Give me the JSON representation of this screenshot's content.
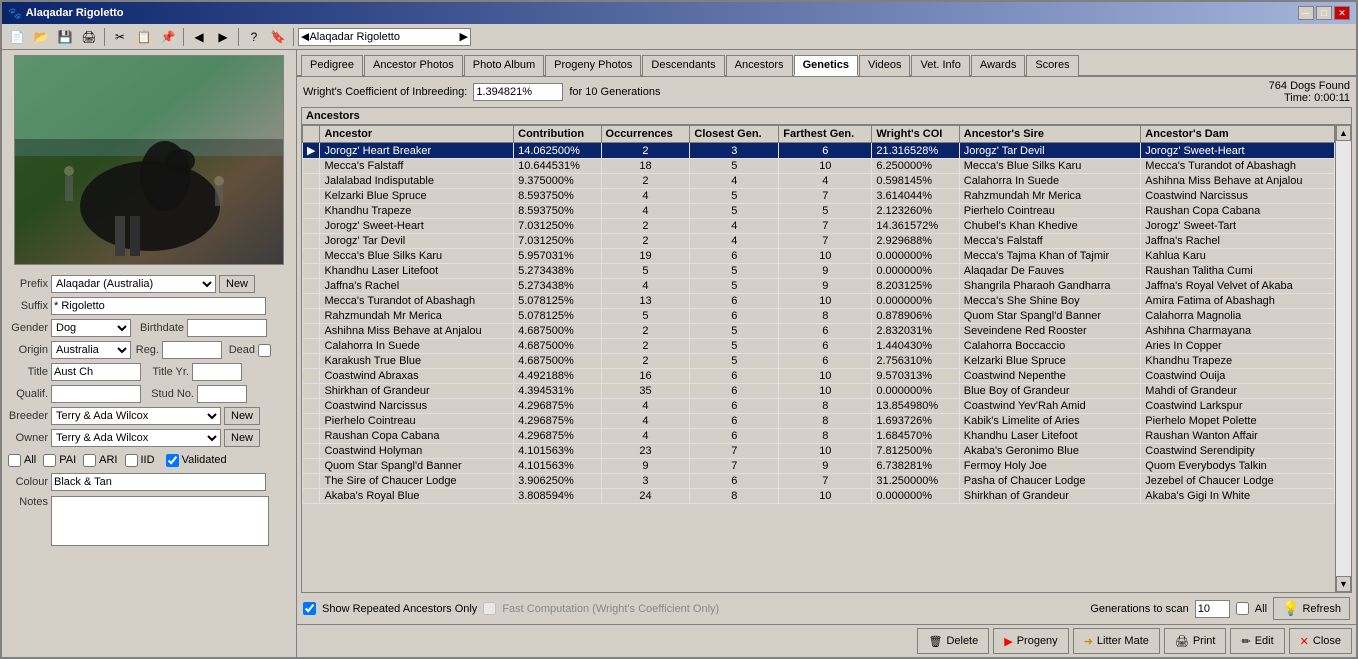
{
  "window": {
    "title": "Alaqadar Rigoletto",
    "app_icon": "🐾"
  },
  "toolbar": {
    "search_value": "Alaqadar Rigoletto",
    "search_placeholder": "Search..."
  },
  "dog": {
    "prefix_label": "Prefix",
    "prefix_value": "Alaqadar (Australia)",
    "suffix_label": "Suffix",
    "suffix_value": "* Rigoletto",
    "gender_label": "Gender",
    "gender_value": "Dog",
    "birthdate_label": "Birthdate",
    "birthdate_value": "/ /",
    "origin_label": "Origin",
    "origin_value": "Australia",
    "reg_label": "Reg.",
    "dead_label": "Dead",
    "title_label": "Title",
    "title_value": "Aust Ch",
    "title_yr_label": "Title Yr.",
    "title_yr_value": "",
    "qualif_label": "Qualif.",
    "stud_no_label": "Stud No.",
    "breeder_label": "Breeder",
    "breeder_value": "Terry & Ada Wilcox",
    "owner_label": "Owner",
    "owner_value": "Terry & Ada Wilcox",
    "all_label": "All",
    "pai_label": "PAI",
    "ari_label": "ARI",
    "iid_label": "IID",
    "validated_label": "Validated",
    "colour_label": "Colour",
    "colour_value": "Black & Tan",
    "notes_label": "Notes",
    "new_prefix_btn": "New",
    "new_breeder_btn": "New",
    "new_owner_btn": "New"
  },
  "tabs": [
    {
      "id": "pedigree",
      "label": "Pedigree"
    },
    {
      "id": "ancestor-photos",
      "label": "Ancestor Photos"
    },
    {
      "id": "photo-album",
      "label": "Photo Album"
    },
    {
      "id": "progeny-photos",
      "label": "Progeny Photos"
    },
    {
      "id": "descendants",
      "label": "Descendants"
    },
    {
      "id": "ancestors",
      "label": "Ancestors"
    },
    {
      "id": "genetics",
      "label": "Genetics",
      "active": true
    },
    {
      "id": "videos",
      "label": "Videos"
    },
    {
      "id": "vet-info",
      "label": "Vet. Info"
    },
    {
      "id": "awards",
      "label": "Awards"
    },
    {
      "id": "scores",
      "label": "Scores"
    }
  ],
  "genetics": {
    "coeff_label": "Wright's Coefficient of Inbreeding:",
    "coeff_value": "1.394821%",
    "generations_label": "for 10 Generations",
    "status": {
      "dogs_found": "764 Dogs Found",
      "time": "Time: 0:00:11"
    },
    "ancestors_title": "Ancestors",
    "columns": [
      {
        "id": "ancestor",
        "label": "Ancestor"
      },
      {
        "id": "contribution",
        "label": "Contribution"
      },
      {
        "id": "occurrences",
        "label": "Occurrences"
      },
      {
        "id": "closest_gen",
        "label": "Closest Gen."
      },
      {
        "id": "farthest_gen",
        "label": "Farthest Gen."
      },
      {
        "id": "wrights_coi",
        "label": "Wright's COI"
      },
      {
        "id": "ancestor_sire",
        "label": "Ancestor's Sire"
      },
      {
        "id": "ancestor_dam",
        "label": "Ancestor's Dam"
      }
    ],
    "rows": [
      {
        "ancestor": "Jorogz' Heart Breaker",
        "contribution": "14.062500%",
        "occurrences": "2",
        "closest": "3",
        "farthest": "6",
        "coi": "21.316528%",
        "sire": "Jorogz' Tar Devil",
        "dam": "Jorogz' Sweet-Heart",
        "selected": true
      },
      {
        "ancestor": "Mecca's Falstaff",
        "contribution": "10.644531%",
        "occurrences": "18",
        "closest": "5",
        "farthest": "10",
        "coi": "6.250000%",
        "sire": "Mecca's Blue Silks Karu",
        "dam": "Mecca's Turandot of Abashagh"
      },
      {
        "ancestor": "Jalalabad Indisputable",
        "contribution": "9.375000%",
        "occurrences": "2",
        "closest": "4",
        "farthest": "4",
        "coi": "0.598145%",
        "sire": "Calahorra In Suede",
        "dam": "Ashihna Miss Behave at Anjalou"
      },
      {
        "ancestor": "Kelzarki Blue Spruce",
        "contribution": "8.593750%",
        "occurrences": "4",
        "closest": "5",
        "farthest": "7",
        "coi": "3.614044%",
        "sire": "Rahzmundah Mr Merica",
        "dam": "Coastwind Narcissus"
      },
      {
        "ancestor": "Khandhu Trapeze",
        "contribution": "8.593750%",
        "occurrences": "4",
        "closest": "5",
        "farthest": "5",
        "coi": "2.123260%",
        "sire": "Pierhelo Cointreau",
        "dam": "Raushan Copa Cabana"
      },
      {
        "ancestor": "Jorogz' Sweet-Heart",
        "contribution": "7.031250%",
        "occurrences": "2",
        "closest": "4",
        "farthest": "7",
        "coi": "14.361572%",
        "sire": "Chubel's Khan Khedive",
        "dam": "Jorogz' Sweet-Tart"
      },
      {
        "ancestor": "Jorogz' Tar Devil",
        "contribution": "7.031250%",
        "occurrences": "2",
        "closest": "4",
        "farthest": "7",
        "coi": "2.929688%",
        "sire": "Mecca's Falstaff",
        "dam": "Jaffna's Rachel"
      },
      {
        "ancestor": "Mecca's Blue Silks Karu",
        "contribution": "5.957031%",
        "occurrences": "19",
        "closest": "6",
        "farthest": "10",
        "coi": "0.000000%",
        "sire": "Mecca's Tajma Khan of Tajmir",
        "dam": "Kahlua Karu"
      },
      {
        "ancestor": "Khandhu Laser Litefoot",
        "contribution": "5.273438%",
        "occurrences": "5",
        "closest": "5",
        "farthest": "9",
        "coi": "0.000000%",
        "sire": "Alaqadar De Fauves",
        "dam": "Raushan Talitha Cumi"
      },
      {
        "ancestor": "Jaffna's Rachel",
        "contribution": "5.273438%",
        "occurrences": "4",
        "closest": "5",
        "farthest": "9",
        "coi": "8.203125%",
        "sire": "Shangrila Pharaoh Gandharra",
        "dam": "Jaffna's Royal Velvet  of Akaba"
      },
      {
        "ancestor": "Mecca's Turandot of Abashagh",
        "contribution": "5.078125%",
        "occurrences": "13",
        "closest": "6",
        "farthest": "10",
        "coi": "0.000000%",
        "sire": "Mecca's She Shine Boy",
        "dam": "Amira Fatima of Abashagh"
      },
      {
        "ancestor": "Rahzmundah Mr Merica",
        "contribution": "5.078125%",
        "occurrences": "5",
        "closest": "6",
        "farthest": "8",
        "coi": "0.878906%",
        "sire": "Quom Star Spangl'd Banner",
        "dam": "Calahorra Magnolia"
      },
      {
        "ancestor": "Ashihna Miss Behave at Anjalou",
        "contribution": "4.687500%",
        "occurrences": "2",
        "closest": "5",
        "farthest": "6",
        "coi": "2.832031%",
        "sire": "Seveindene Red Rooster",
        "dam": "Ashihna Charmayana"
      },
      {
        "ancestor": "Calahorra In Suede",
        "contribution": "4.687500%",
        "occurrences": "2",
        "closest": "5",
        "farthest": "6",
        "coi": "1.440430%",
        "sire": "Calahorra Boccaccio",
        "dam": "Aries In Copper"
      },
      {
        "ancestor": "Karakush True Blue",
        "contribution": "4.687500%",
        "occurrences": "2",
        "closest": "5",
        "farthest": "6",
        "coi": "2.756310%",
        "sire": "Kelzarki Blue Spruce",
        "dam": "Khandhu Trapeze"
      },
      {
        "ancestor": "Coastwind Abraxas",
        "contribution": "4.492188%",
        "occurrences": "16",
        "closest": "6",
        "farthest": "10",
        "coi": "9.570313%",
        "sire": "Coastwind Nepenthe",
        "dam": "Coastwind Ouija"
      },
      {
        "ancestor": "Shirkhan of Grandeur",
        "contribution": "4.394531%",
        "occurrences": "35",
        "closest": "6",
        "farthest": "10",
        "coi": "0.000000%",
        "sire": "Blue Boy of Grandeur",
        "dam": "Mahdi of Grandeur"
      },
      {
        "ancestor": "Coastwind Narcissus",
        "contribution": "4.296875%",
        "occurrences": "4",
        "closest": "6",
        "farthest": "8",
        "coi": "13.854980%",
        "sire": "Coastwind Yev'Rah Amid",
        "dam": "Coastwind Larkspur"
      },
      {
        "ancestor": "Pierhelo Cointreau",
        "contribution": "4.296875%",
        "occurrences": "4",
        "closest": "6",
        "farthest": "8",
        "coi": "1.693726%",
        "sire": "Kabik's Limelite of Aries",
        "dam": "Pierhelo Mopet Polette"
      },
      {
        "ancestor": "Raushan Copa Cabana",
        "contribution": "4.296875%",
        "occurrences": "4",
        "closest": "6",
        "farthest": "8",
        "coi": "1.684570%",
        "sire": "Khandhu Laser Litefoot",
        "dam": "Raushan Wanton Affair"
      },
      {
        "ancestor": "Coastwind Holyman",
        "contribution": "4.101563%",
        "occurrences": "23",
        "closest": "7",
        "farthest": "10",
        "coi": "7.812500%",
        "sire": "Akaba's Geronimo Blue",
        "dam": "Coastwind Serendipity"
      },
      {
        "ancestor": "Quom Star Spangl'd Banner",
        "contribution": "4.101563%",
        "occurrences": "9",
        "closest": "7",
        "farthest": "9",
        "coi": "6.738281%",
        "sire": "Fermoy Holy Joe",
        "dam": "Quom Everybodys Talkin"
      },
      {
        "ancestor": "The Sire of Chaucer Lodge",
        "contribution": "3.906250%",
        "occurrences": "3",
        "closest": "6",
        "farthest": "7",
        "coi": "31.250000%",
        "sire": "Pasha of Chaucer Lodge",
        "dam": "Jezebel of Chaucer Lodge"
      },
      {
        "ancestor": "Akaba's Royal Blue",
        "contribution": "3.808594%",
        "occurrences": "24",
        "closest": "8",
        "farthest": "10",
        "coi": "0.000000%",
        "sire": "Shirkhan of Grandeur",
        "dam": "Akaba's Gigi In White"
      }
    ],
    "bottom": {
      "show_repeated": "Show Repeated Ancestors Only",
      "fast_computation": "Fast Computation (Wright's Coefficient Only)",
      "gen_label": "Generations to scan",
      "gen_value": "10",
      "all_label": "All",
      "refresh_label": "Refresh"
    }
  },
  "actions": {
    "delete_label": "Delete",
    "progeny_label": "Progeny",
    "litter_mate_label": "Litter Mate",
    "print_label": "Print",
    "edit_label": "Edit",
    "close_label": "Close"
  }
}
